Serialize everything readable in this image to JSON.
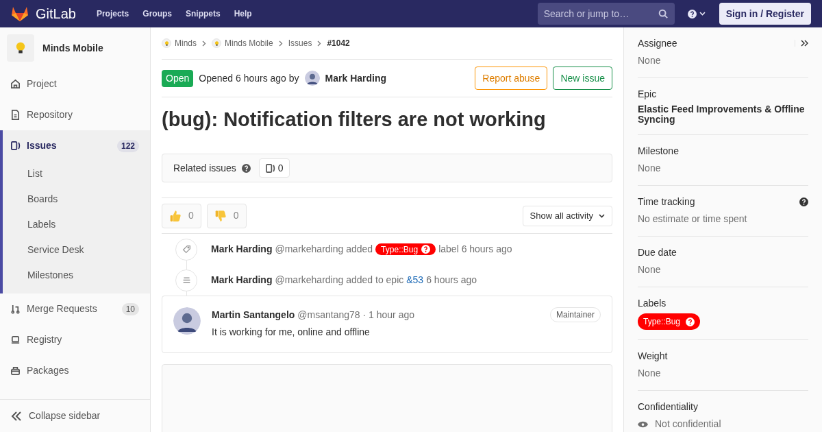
{
  "header": {
    "brand": "GitLab",
    "nav": [
      "Projects",
      "Groups",
      "Snippets",
      "Help"
    ],
    "search": {
      "placeholder": "Search or jump to…"
    },
    "sign_in": "Sign in / Register"
  },
  "sidebar": {
    "project": "Minds Mobile",
    "items": [
      {
        "kind": "home",
        "label": "Project",
        "selected": false
      },
      {
        "kind": "doc",
        "label": "Repository",
        "selected": false
      },
      {
        "kind": "issues",
        "label": "Issues",
        "count": "122",
        "selected": true,
        "children": [
          {
            "label": "List"
          },
          {
            "label": "Boards"
          },
          {
            "label": "Labels"
          },
          {
            "label": "Service Desk"
          },
          {
            "label": "Milestones"
          }
        ]
      },
      {
        "kind": "merge",
        "label": "Merge Requests",
        "count": "10",
        "selected": false
      },
      {
        "kind": "registry",
        "label": "Registry",
        "selected": false
      },
      {
        "kind": "package",
        "label": "Packages",
        "selected": false
      }
    ],
    "collapse": "Collapse sidebar"
  },
  "breadcrumbs": [
    {
      "label": "Minds",
      "avatar": true,
      "current": false
    },
    {
      "label": "Minds Mobile",
      "avatar": true,
      "current": false
    },
    {
      "label": "Issues",
      "avatar": false,
      "current": false
    },
    {
      "label": "#1042",
      "avatar": false,
      "current": true
    }
  ],
  "issue": {
    "status": "Open",
    "opened": "Opened 6 hours ago by",
    "author": "Mark Harding",
    "buttons": [
      {
        "kind": "warning",
        "label": "Report abuse"
      },
      {
        "kind": "success",
        "label": "New issue"
      }
    ],
    "title": "(bug): Notification filters are not working"
  },
  "related": {
    "label": "Related issues",
    "count": "0"
  },
  "reactions": [
    {
      "kind": "up",
      "count": "0"
    },
    {
      "kind": "down",
      "count": "0"
    }
  ],
  "activity_filter": "Show all activity",
  "events": [
    {
      "kind": "label",
      "author": "Mark Harding",
      "parts": [
        {
          "kind": "text",
          "text": "@markeharding added"
        },
        {
          "kind": "label",
          "text": "Type::Bug",
          "color": "#ff0000"
        },
        {
          "kind": "text",
          "text": "label 6 hours ago"
        }
      ]
    },
    {
      "kind": "epic",
      "author": "Mark Harding",
      "parts": [
        {
          "kind": "text",
          "text": "@markeharding added to epic"
        },
        {
          "kind": "link",
          "text": "&53"
        },
        {
          "kind": "text",
          "text": "6 hours ago"
        }
      ]
    }
  ],
  "comment": {
    "author": "Martin Santangelo",
    "meta": "@msantang78 · 1 hour ago",
    "role": "Maintainer",
    "body": "It is working for me, online and offline"
  },
  "details": [
    {
      "kind": "text",
      "title": "Assignee",
      "value": "None",
      "collapse": true
    },
    {
      "kind": "bold",
      "title": "Epic",
      "value": "Elastic Feed Improvements & Offline Syncing"
    },
    {
      "kind": "text",
      "title": "Milestone",
      "value": "None"
    },
    {
      "kind": "text",
      "title": "Time tracking",
      "value": "No estimate or time spent",
      "help": true
    },
    {
      "kind": "text",
      "title": "Due date",
      "value": "None"
    },
    {
      "kind": "label",
      "title": "Labels",
      "value": "Type::Bug",
      "color": "#ff0000"
    },
    {
      "kind": "text",
      "title": "Weight",
      "value": "None"
    },
    {
      "kind": "eye",
      "title": "Confidentiality",
      "value": "Not confidential"
    }
  ]
}
